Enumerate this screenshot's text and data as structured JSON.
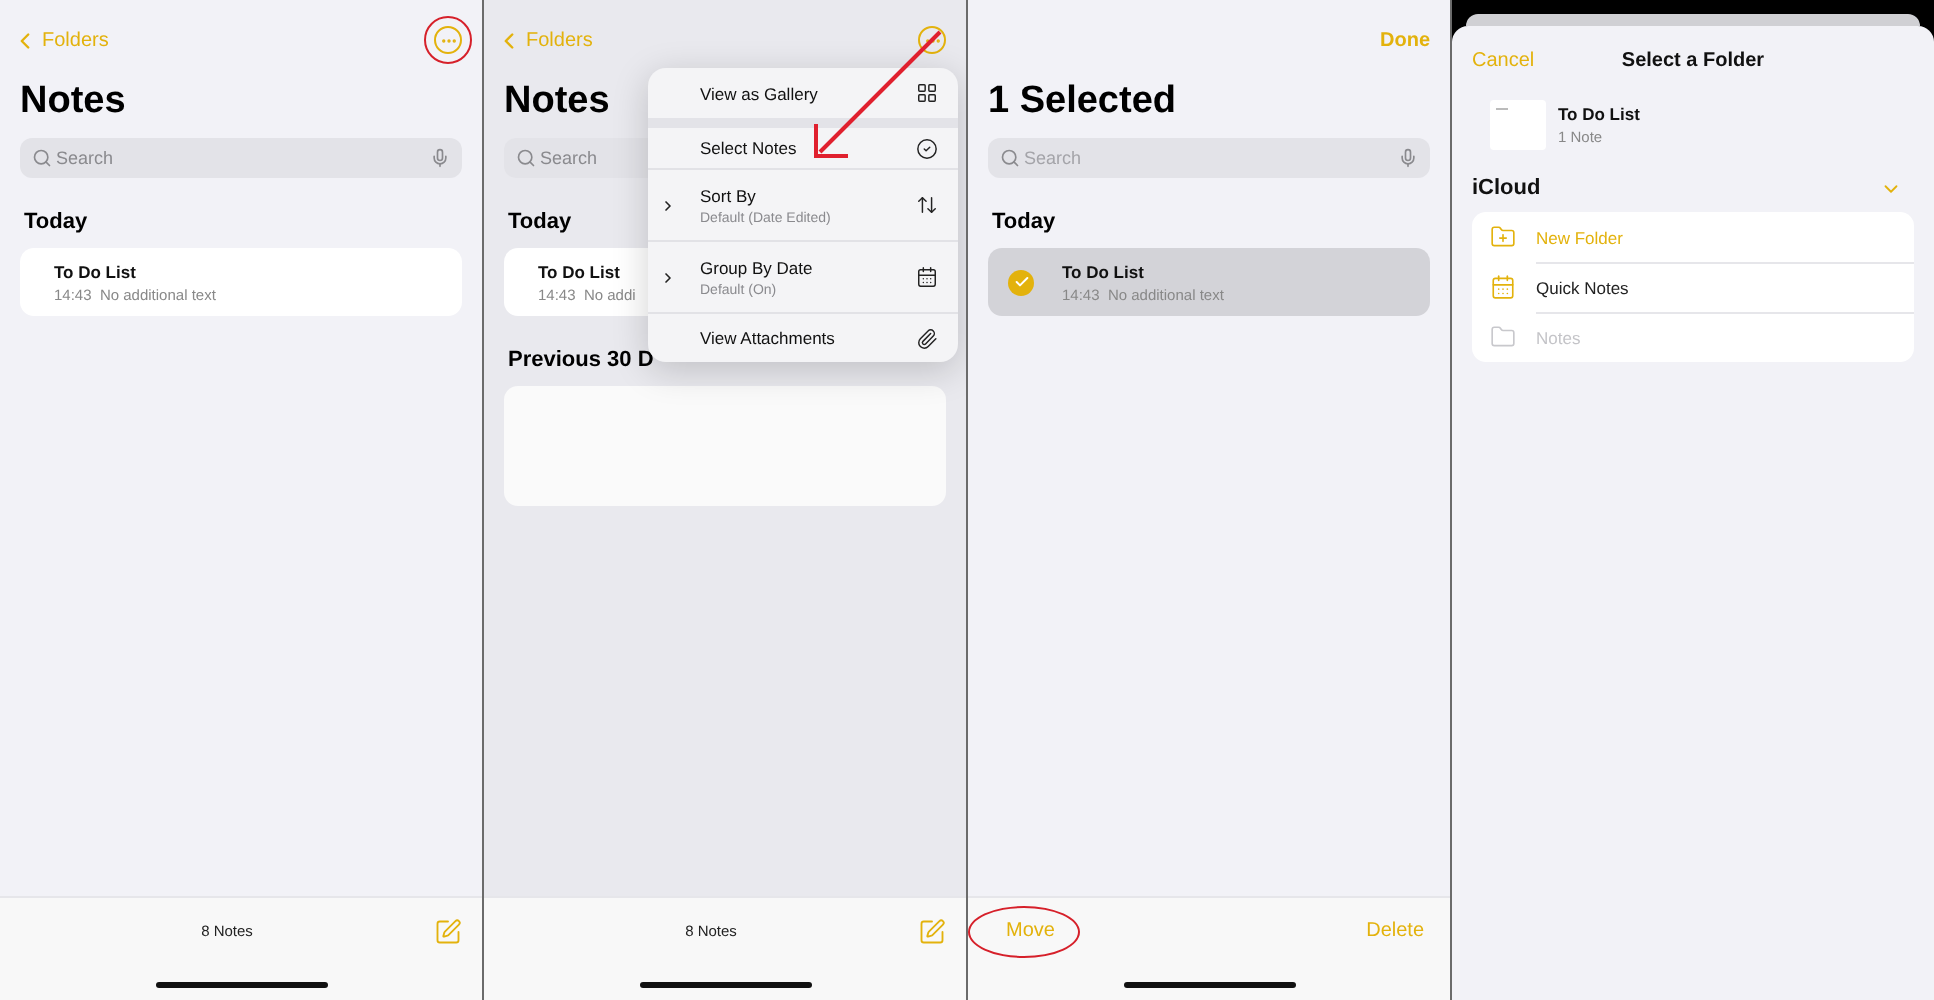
{
  "panels": [
    {
      "kind": "notes",
      "nav": {
        "back": "Folders",
        "more_circled": true
      },
      "title": "Notes",
      "search": {
        "placeholder": "Search",
        "disabled": false
      },
      "sections": [
        {
          "heading": "Today",
          "notes": [
            {
              "title": "To Do List",
              "time": "14:43",
              "preview": "No additional text"
            }
          ]
        }
      ],
      "footer": {
        "kind": "count",
        "count": "8 Notes"
      }
    },
    {
      "kind": "notes",
      "nav": {
        "back": "Folders"
      },
      "title": "Notes",
      "search": {
        "placeholder": "Search",
        "disabled": false
      },
      "sections": [
        {
          "heading": "Today",
          "notes": [
            {
              "title": "To Do List",
              "time": "14:43",
              "preview": "No addi"
            }
          ]
        },
        {
          "heading": "Previous 30 D"
        }
      ],
      "pointer_arrow": true,
      "menu": [
        {
          "kind": "action",
          "label": "View as Gallery"
        },
        {
          "kind": "action",
          "label": "Select Notes"
        },
        {
          "kind": "submenu",
          "label": "Sort By",
          "subtitle": "Default (Date Edited)"
        },
        {
          "kind": "submenu",
          "label": "Group By Date",
          "subtitle": "Default (On)"
        },
        {
          "kind": "action",
          "label": "View Attachments"
        }
      ],
      "footer": {
        "kind": "count",
        "count": "8 Notes"
      }
    },
    {
      "kind": "select",
      "nav": {
        "done": "Done"
      },
      "title": "1 Selected",
      "search": {
        "placeholder": "Search",
        "disabled": true
      },
      "sections": [
        {
          "heading": "Today",
          "notes": [
            {
              "title": "To Do List",
              "time": "14:43",
              "preview": "No additional text",
              "selected": true
            }
          ]
        }
      ],
      "footer": {
        "kind": "actions",
        "move": "Move",
        "move_circled": true,
        "delete": "Delete"
      }
    },
    {
      "kind": "sheet",
      "cancel": "Cancel",
      "title": "Select a Folder",
      "note": {
        "title": "To Do List",
        "count": "1 Note"
      },
      "account": {
        "name": "iCloud",
        "expanded": true
      },
      "folders": [
        {
          "kind": "new",
          "label": "New Folder",
          "disabled": false
        },
        {
          "kind": "quick",
          "label": "Quick Notes",
          "disabled": false
        },
        {
          "kind": "folder",
          "label": "Notes",
          "disabled": true
        }
      ]
    }
  ]
}
